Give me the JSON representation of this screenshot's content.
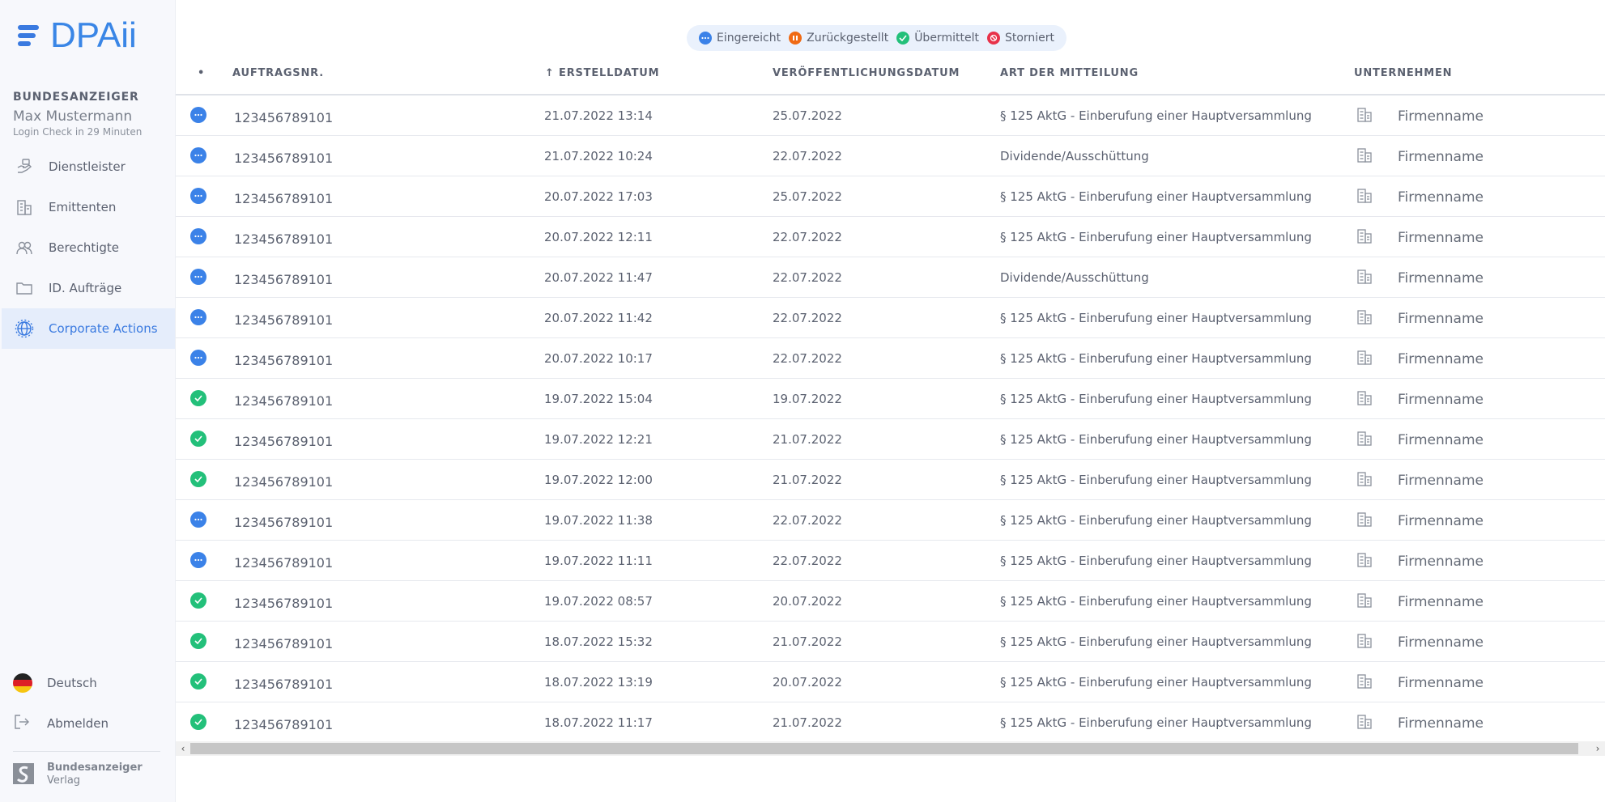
{
  "app": {
    "logo_text": "DPAii",
    "org": "BUNDESANZEIGER",
    "user_name": "Max Mustermann",
    "login_check": "Login Check in 29 Minuten"
  },
  "sidebar": {
    "items": [
      {
        "label": "Dienstleister",
        "icon": "hand-icon",
        "active": false
      },
      {
        "label": "Emittenten",
        "icon": "building-icon",
        "active": false
      },
      {
        "label": "Berechtigte",
        "icon": "users-icon",
        "active": false
      },
      {
        "label": "ID. Aufträge",
        "icon": "folder-icon",
        "active": false
      },
      {
        "label": "Corporate Actions",
        "icon": "globe-gear-icon",
        "active": true
      }
    ],
    "language": "Deutsch",
    "logout": "Abmelden",
    "brand_line1": "Bundesanzeiger",
    "brand_line2": "Verlag"
  },
  "legend": [
    {
      "label": "Eingereicht",
      "color": "#3b82e8",
      "icon": "dots-icon"
    },
    {
      "label": "Zurückgestellt",
      "color": "#f06a14",
      "icon": "pause-icon"
    },
    {
      "label": "Übermittelt",
      "color": "#23c07a",
      "icon": "check-icon"
    },
    {
      "label": "Storniert",
      "color": "#e8324a",
      "icon": "cancel-icon"
    }
  ],
  "table": {
    "headers": {
      "dot": "•",
      "nr": "AUFTRAGSNR.",
      "erstell": "↑ ERSTELLDATUM",
      "veroef": "VERÖFFENTLICHUNGSDATUM",
      "art": "ART DER MITTEILUNG",
      "unternehmen": "UNTERNEHMEN"
    },
    "rows": [
      {
        "status": "eingereicht",
        "nr": "123456789101",
        "erstell": "21.07.2022 13:14",
        "veroef": "25.07.2022",
        "art": "§ 125 AktG - Einberufung einer Hauptversammlung",
        "firma": "Firmenname"
      },
      {
        "status": "eingereicht",
        "nr": "123456789101",
        "erstell": "21.07.2022 10:24",
        "veroef": "22.07.2022",
        "art": "Dividende/Ausschüttung",
        "firma": "Firmenname"
      },
      {
        "status": "eingereicht",
        "nr": "123456789101",
        "erstell": "20.07.2022 17:03",
        "veroef": "25.07.2022",
        "art": "§ 125 AktG - Einberufung einer Hauptversammlung",
        "firma": "Firmenname"
      },
      {
        "status": "eingereicht",
        "nr": "123456789101",
        "erstell": "20.07.2022 12:11",
        "veroef": "22.07.2022",
        "art": "§ 125 AktG - Einberufung einer Hauptversammlung",
        "firma": "Firmenname"
      },
      {
        "status": "eingereicht",
        "nr": "123456789101",
        "erstell": "20.07.2022 11:47",
        "veroef": "22.07.2022",
        "art": "Dividende/Ausschüttung",
        "firma": "Firmenname"
      },
      {
        "status": "eingereicht",
        "nr": "123456789101",
        "erstell": "20.07.2022 11:42",
        "veroef": "22.07.2022",
        "art": "§ 125 AktG - Einberufung einer Hauptversammlung",
        "firma": "Firmenname"
      },
      {
        "status": "eingereicht",
        "nr": "123456789101",
        "erstell": "20.07.2022 10:17",
        "veroef": "22.07.2022",
        "art": "§ 125 AktG - Einberufung einer Hauptversammlung",
        "firma": "Firmenname"
      },
      {
        "status": "uebermittelt",
        "nr": "123456789101",
        "erstell": "19.07.2022 15:04",
        "veroef": "19.07.2022",
        "art": "§ 125 AktG - Einberufung einer Hauptversammlung",
        "firma": "Firmenname"
      },
      {
        "status": "uebermittelt",
        "nr": "123456789101",
        "erstell": "19.07.2022 12:21",
        "veroef": "21.07.2022",
        "art": "§ 125 AktG - Einberufung einer Hauptversammlung",
        "firma": "Firmenname"
      },
      {
        "status": "uebermittelt",
        "nr": "123456789101",
        "erstell": "19.07.2022 12:00",
        "veroef": "21.07.2022",
        "art": "§ 125 AktG - Einberufung einer Hauptversammlung",
        "firma": "Firmenname"
      },
      {
        "status": "eingereicht",
        "nr": "123456789101",
        "erstell": "19.07.2022 11:38",
        "veroef": "22.07.2022",
        "art": "§ 125 AktG - Einberufung einer Hauptversammlung",
        "firma": "Firmenname"
      },
      {
        "status": "eingereicht",
        "nr": "123456789101",
        "erstell": "19.07.2022 11:11",
        "veroef": "22.07.2022",
        "art": "§ 125 AktG - Einberufung einer Hauptversammlung",
        "firma": "Firmenname"
      },
      {
        "status": "uebermittelt",
        "nr": "123456789101",
        "erstell": "19.07.2022 08:57",
        "veroef": "20.07.2022",
        "art": "§ 125 AktG - Einberufung einer Hauptversammlung",
        "firma": "Firmenname"
      },
      {
        "status": "uebermittelt",
        "nr": "123456789101",
        "erstell": "18.07.2022 15:32",
        "veroef": "21.07.2022",
        "art": "§ 125 AktG - Einberufung einer Hauptversammlung",
        "firma": "Firmenname"
      },
      {
        "status": "uebermittelt",
        "nr": "123456789101",
        "erstell": "18.07.2022 13:19",
        "veroef": "20.07.2022",
        "art": "§ 125 AktG - Einberufung einer Hauptversammlung",
        "firma": "Firmenname"
      },
      {
        "status": "uebermittelt",
        "nr": "123456789101",
        "erstell": "18.07.2022 11:17",
        "veroef": "21.07.2022",
        "art": "§ 125 AktG - Einberufung einer Hauptversammlung",
        "firma": "Firmenname"
      }
    ]
  },
  "colors": {
    "eingereicht": "#3b82e8",
    "uebermittelt": "#23c07a",
    "accent": "#3a7ae0"
  }
}
